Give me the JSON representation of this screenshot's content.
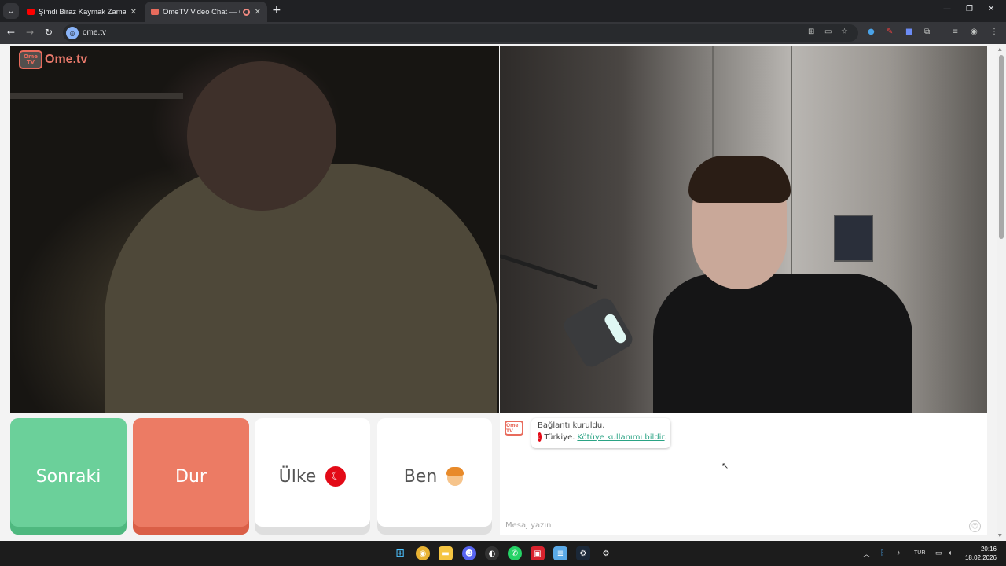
{
  "browser": {
    "tabs": [
      {
        "title": "Şimdi Biraz Kaymak Zamanısss"
      },
      {
        "title": "OmeTV Video Chat — Ome"
      }
    ],
    "new_tab_icon": "+",
    "address": "ome.tv"
  },
  "page": {
    "logo": {
      "box": "Ome TV",
      "text": "Ome.tv"
    },
    "buttons": {
      "next": "Sonraki",
      "stop": "Dur",
      "country": "Ülke",
      "gender": "Ben"
    },
    "chat": {
      "logo": "Ome TV",
      "status": "Bağlantı kuruldu.",
      "country": "Türkiye.",
      "report_link": "Kötüye kullanımı bildir",
      "after_link": ".",
      "input_placeholder": "Mesaj yazın"
    }
  },
  "taskbar": {
    "language": "TUR",
    "time": "20:16",
    "date": "18.02.2026"
  },
  "colors": {
    "next": "#6bd09a",
    "stop": "#ec7b64",
    "accent_link": "#2aa384",
    "logo": "#e86b5c"
  }
}
